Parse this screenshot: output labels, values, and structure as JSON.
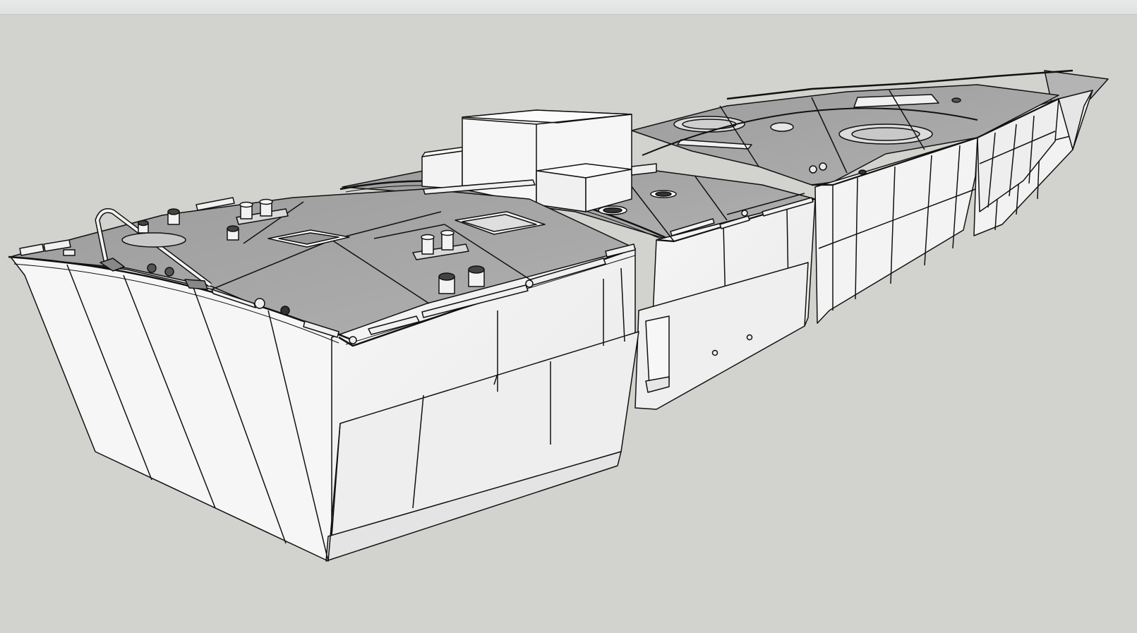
{
  "viewport": {
    "background_color": "#d2d2ce",
    "face_color": "#f4f4f4",
    "deck_color": "#a4a4a4",
    "edge_color": "#111111"
  },
  "model": {
    "segments": [
      {
        "id": "stern-module",
        "deck": "gray"
      },
      {
        "id": "mid-module",
        "deck": "gray"
      },
      {
        "id": "bow-module-1",
        "deck": "gray"
      },
      {
        "id": "bow-module-2",
        "deck": "gray"
      }
    ],
    "icons": [
      "bollard-icon",
      "vent-icon",
      "hatch-icon",
      "porthole-icon",
      "tow-arch-icon"
    ]
  }
}
